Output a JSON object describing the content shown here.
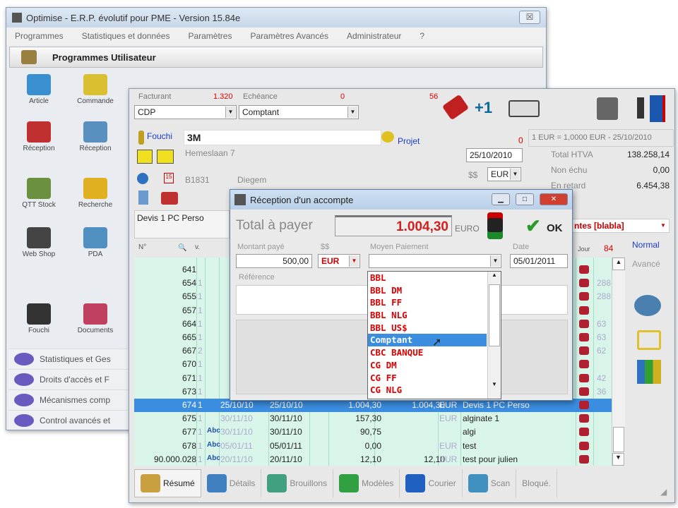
{
  "back_window": {
    "title": "Optimise  -  E.R.P. évolutif pour PME  -  Version 15.84e",
    "close": "☒",
    "menu": [
      "Programmes",
      "Statistiques et données",
      "Paramètres",
      "Paramètres Avancés",
      "Administrateur",
      "?"
    ],
    "section_title": "Programmes Utilisateur",
    "tiles": [
      {
        "label": "Article",
        "color": "#3a8fd0"
      },
      {
        "label": "Commande",
        "color": "#d8c030"
      },
      {
        "label": "Réception",
        "color": "#c03030"
      },
      {
        "label": "Réception",
        "color": "#5a90c0"
      },
      {
        "label": "QTT Stock",
        "color": "#6a9040"
      },
      {
        "label": "Recherche",
        "color": "#e0b020"
      },
      {
        "label": "Web Shop",
        "color": "#444"
      },
      {
        "label": "PDA",
        "color": "#5090c0"
      },
      {
        "label": "Fouchi",
        "color": "#333"
      },
      {
        "label": "Documents",
        "color": "#c04060"
      }
    ],
    "left_list": [
      "Statistiques et Ges",
      "Droits d'accès et F",
      "Mécanismes comp",
      "Control avancés et"
    ]
  },
  "front_window": {
    "facturant_label": "Facturant",
    "facturant_count": "1.320",
    "facturant_value": "CDP",
    "echeance_label": "Echéance",
    "echeance_count": "0",
    "echeance_count2": "56",
    "echeance_value": "Comptant",
    "client_link": "Fouchi",
    "client_name": "3M",
    "projet_link": "Projet",
    "address": "Hemeslaan 7",
    "postcode": "B1831",
    "city": "Diegem",
    "zero": "0",
    "date": "25/10/2010",
    "currency_label": "$$",
    "currency": "EUR",
    "rate": "1 EUR = 1,0000 EUR - 25/10/2010",
    "totals": [
      {
        "label": "Total HTVA",
        "value": "138.258,14"
      },
      {
        "label": "Non échu",
        "value": "0,00"
      },
      {
        "label": "En retard",
        "value": "6.454,38"
      }
    ],
    "doc_name": "Devis 1 PC Perso",
    "status_select": "ntes [blabla]",
    "col_no": "N°",
    "col_v": "v.",
    "col_jour": "Jour",
    "count84": "84",
    "mode_normal": "Normal",
    "mode_avance": "Avancé",
    "rows": [
      {
        "no": "641",
        "v": "",
        "abc": "",
        "d1": "",
        "d2": "",
        "amt": "",
        "amt2": "",
        "cur": "",
        "desc": "",
        "num": ""
      },
      {
        "no": "654",
        "v": "1",
        "abc": "",
        "d1": "",
        "d2": "",
        "amt": "",
        "amt2": "",
        "cur": "",
        "desc": "",
        "num": "288"
      },
      {
        "no": "655",
        "v": "1",
        "abc": "",
        "d1": "",
        "d2": "",
        "amt": "",
        "amt2": "",
        "cur": "",
        "desc": "",
        "num": "288"
      },
      {
        "no": "657",
        "v": "1",
        "abc": "",
        "d1": "",
        "d2": "",
        "amt": "",
        "amt2": "",
        "cur": "",
        "desc": "",
        "num": ""
      },
      {
        "no": "664",
        "v": "1",
        "abc": "",
        "d1": "",
        "d2": "",
        "amt": "",
        "amt2": "",
        "cur": "",
        "desc": "",
        "num": "63"
      },
      {
        "no": "665",
        "v": "1",
        "abc": "",
        "d1": "",
        "d2": "",
        "amt": "",
        "amt2": "",
        "cur": "",
        "desc": "",
        "num": "63"
      },
      {
        "no": "667",
        "v": "2",
        "abc": "",
        "d1": "",
        "d2": "",
        "amt": "",
        "amt2": "",
        "cur": "",
        "desc": "",
        "num": "62"
      },
      {
        "no": "670",
        "v": "1",
        "abc": "",
        "d1": "",
        "d2": "",
        "amt": "",
        "amt2": "",
        "cur": "",
        "desc": "",
        "num": ""
      },
      {
        "no": "671",
        "v": "1",
        "abc": "",
        "d1": "",
        "d2": "",
        "amt": "",
        "amt2": "",
        "cur": "",
        "desc": "",
        "num": "42"
      },
      {
        "no": "673",
        "v": "1",
        "abc": "",
        "d1": "",
        "d2": "",
        "amt": "",
        "amt2": "",
        "cur": "",
        "desc": "",
        "num": "36"
      },
      {
        "no": "674",
        "v": "1",
        "abc": "",
        "d1": "25/10/10",
        "d2": "25/10/10",
        "amt": "1.004,30",
        "amt2": "1.004,30",
        "cur": "EUR",
        "desc": "Devis 1 PC Perso",
        "num": ""
      },
      {
        "no": "675",
        "v": "1",
        "abc": "",
        "d1": "30/11/10",
        "d2": "30/11/10",
        "amt": "157,30",
        "amt2": "",
        "cur": "EUR",
        "desc": "alginate 1",
        "num": ""
      },
      {
        "no": "677",
        "v": "1",
        "abc": "Abc",
        "d1": "30/11/10",
        "d2": "30/11/10",
        "amt": "90,75",
        "amt2": "",
        "cur": "",
        "desc": "algi",
        "num": ""
      },
      {
        "no": "678",
        "v": "1",
        "abc": "Abc",
        "d1": "05/01/11",
        "d2": "05/01/11",
        "amt": "0,00",
        "amt2": "",
        "cur": "EUR",
        "desc": "test",
        "num": ""
      },
      {
        "no": "90.000.028",
        "v": "1",
        "abc": "Abc",
        "d1": "20/11/10",
        "d2": "20/11/10",
        "amt": "12,10",
        "amt2": "12,10",
        "cur": "EUR",
        "desc": "test pour julien",
        "num": ""
      }
    ],
    "tabs": [
      "Résumé",
      "Détails",
      "Brouillons",
      "Modèles",
      "Courier",
      "Scan",
      "Bloqué."
    ]
  },
  "dialog": {
    "title": "Réception d'un accompte",
    "total_label": "Total à payer",
    "total_value": "1.004,30",
    "total_currency": "EURO",
    "ok": "OK",
    "montant_label": "Montant payé",
    "montant_value": "500,00",
    "cur_label": "$$",
    "cur_value": "EUR",
    "moyen_label": "Moyen Paiement",
    "moyen_value": "",
    "date_label": "Date",
    "date_value": "05/01/2011",
    "reference_label": "Référence",
    "options": [
      "BBL",
      "BBL DM",
      "BBL FF",
      "BBL NLG",
      "BBL US$",
      "Comptant",
      "CBC BANQUE",
      "CG DM",
      "CG FF",
      "CG NLG"
    ],
    "selected_option": "Comptant"
  }
}
